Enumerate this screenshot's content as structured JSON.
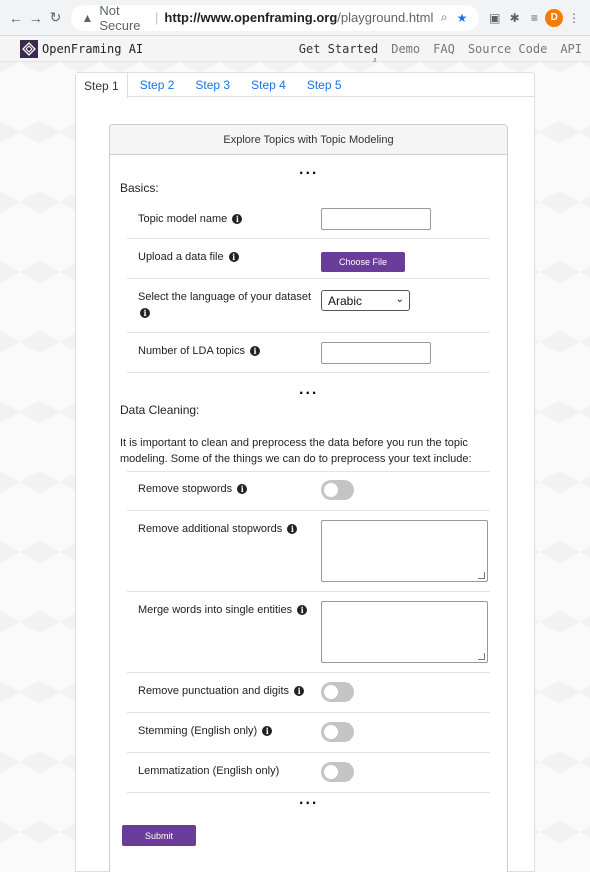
{
  "browser": {
    "warning": "Not Secure",
    "url_host": "http://www.openframing.org",
    "url_path": "/playground.html",
    "avatar_letter": "D"
  },
  "site": {
    "brand": "OpenFraming AI",
    "nav": [
      "Get Started",
      "Demo",
      "FAQ",
      "Source Code",
      "API"
    ]
  },
  "tabs": [
    "Step 1",
    "Step 2",
    "Step 3",
    "Step 4",
    "Step 5"
  ],
  "card": {
    "header": "Explore Topics with Topic Modeling",
    "dots": "...",
    "basics": {
      "title": "Basics:",
      "topic_model_name": "Topic model name",
      "upload_label": "Upload a data file",
      "choose_file": "Choose File",
      "language_label": "Select the language of your dataset",
      "language_value": "Arabic",
      "lda_topics": "Number of LDA topics"
    },
    "cleaning": {
      "title": "Data Cleaning:",
      "intro": "It is important to clean and preprocess the data before you run the topic modeling. Some of the things we can do to preprocess your text include:",
      "remove_stopwords": "Remove stopwords",
      "remove_additional": "Remove additional stopwords",
      "merge_words": "Merge words into single entities",
      "remove_punct": "Remove punctuation and digits",
      "stemming": "Stemming (English only)",
      "lemmatization": "Lemmatization (English only)"
    },
    "submit": "Submit"
  }
}
